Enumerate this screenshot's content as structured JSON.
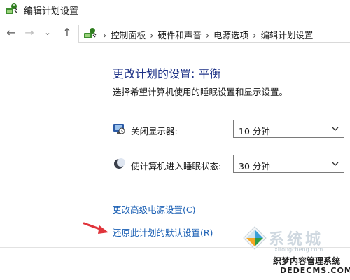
{
  "window": {
    "title": "编辑计划设置"
  },
  "nav": {
    "back_glyph": "←",
    "forward_glyph": "→",
    "recent_glyph": "⌄",
    "up_glyph": "↑"
  },
  "address": {
    "separator": "›",
    "crumbs": [
      "控制面板",
      "硬件和声音",
      "电源选项",
      "编辑计划设置"
    ]
  },
  "content": {
    "heading": "更改计划的设置: 平衡",
    "subtext": "选择希望计算机使用的睡眠设置和显示设置。",
    "display_off": {
      "label": "关闭显示器:",
      "value": "10 分钟",
      "icon": "monitor-timer-icon"
    },
    "sleep": {
      "label": "使计算机进入睡眠状态:",
      "value": "30 分钟",
      "icon": "moon-icon"
    },
    "links": {
      "advanced": "更改高级电源设置(C)",
      "restore": "还原此计划的默认设置(R)"
    }
  },
  "watermark": {
    "brand": "系统城",
    "url": "xitongcheng.com",
    "line1": "织梦内容管理系统",
    "line2": "DEDECMS.COM"
  },
  "colors": {
    "heading": "#1e3287",
    "link": "#1a5fb4",
    "arrow": "#e0343b"
  }
}
